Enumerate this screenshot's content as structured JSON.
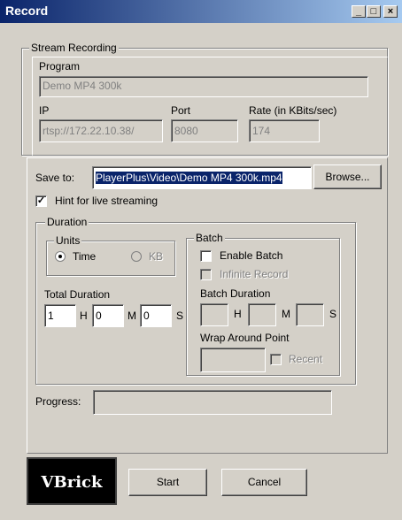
{
  "window": {
    "title": "Record",
    "controls": [
      "_",
      "□",
      "×"
    ]
  },
  "stream": {
    "group_label": "Stream Recording",
    "program_label": "Program",
    "program_value": "Demo MP4 300k",
    "ip_label": "IP",
    "ip_value": "rtsp://172.22.10.38/",
    "port_label": "Port",
    "port_value": "8080",
    "rate_label": "Rate (in KBits/sec)",
    "rate_value": "174"
  },
  "save": {
    "label": "Save to:",
    "value": "PlayerPlus\\Video\\Demo MP4 300k.mp4",
    "browse": "Browse..."
  },
  "hint": {
    "label": "Hint for live streaming",
    "checked": true
  },
  "duration": {
    "group_label": "Duration",
    "units_label": "Units",
    "time_label": "Time",
    "kb_label": "KB",
    "total_label": "Total Duration",
    "h_value": "1",
    "m_value": "0",
    "s_value": "0",
    "h": "H",
    "m": "M",
    "s": "S"
  },
  "batch": {
    "group_label": "Batch",
    "enable_label": "Enable Batch",
    "infinite_label": "Infinite Record",
    "duration_label": "Batch Duration",
    "h": "H",
    "m": "M",
    "s": "S",
    "wrap_label": "Wrap Around Point",
    "recent_label": "Recent"
  },
  "progress": {
    "label": "Progress:"
  },
  "footer": {
    "logo_text": "VBrick",
    "start": "Start",
    "cancel": "Cancel"
  }
}
